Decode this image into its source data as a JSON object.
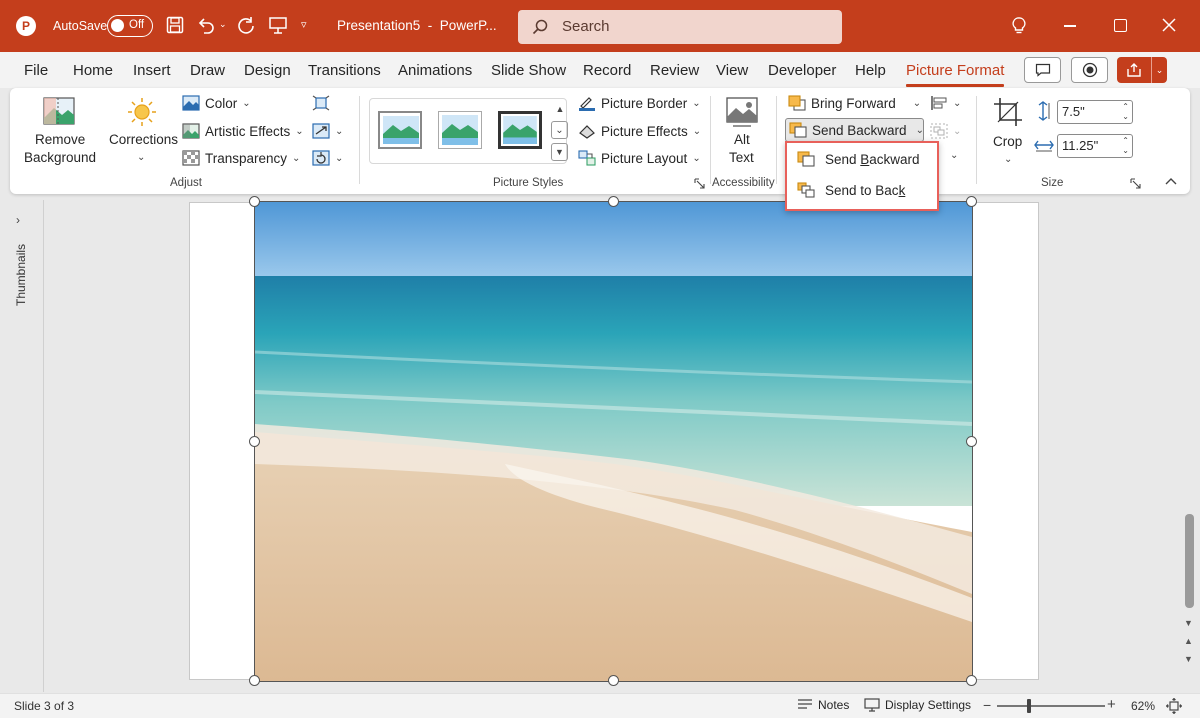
{
  "titlebar": {
    "autosave_label": "AutoSave",
    "autosave_state": "Off",
    "document_title": "Presentation5  -  PowerP...",
    "search_placeholder": "Search"
  },
  "menu_tabs": [
    "File",
    "Home",
    "Insert",
    "Draw",
    "Design",
    "Transitions",
    "Animations",
    "Slide Show",
    "Record",
    "Review",
    "View",
    "Developer",
    "Help",
    "Picture Format"
  ],
  "active_tab": "Picture Format",
  "ribbon": {
    "adjust": {
      "remove_background_line1": "Remove",
      "remove_background_line2": "Background",
      "corrections": "Corrections",
      "color": "Color",
      "artistic_effects": "Artistic Effects",
      "transparency": "Transparency",
      "group_label": "Adjust"
    },
    "picture_styles": {
      "picture_border": "Picture Border",
      "picture_effects": "Picture Effects",
      "picture_layout": "Picture Layout",
      "group_label": "Picture Styles"
    },
    "accessibility": {
      "alt_text_line1": "Alt",
      "alt_text_line2": "Text",
      "group_label": "Accessibility"
    },
    "arrange": {
      "bring_forward": "Bring Forward",
      "send_backward": "Send Backward"
    },
    "size": {
      "crop": "Crop",
      "height": "7.5\"",
      "width": "11.25\"",
      "group_label": "Size"
    }
  },
  "dropdown": {
    "items": [
      {
        "pre": "Send ",
        "key": "B",
        "post": "ackward"
      },
      {
        "pre": "Send to Bac",
        "key": "k",
        "post": ""
      }
    ]
  },
  "left_panel": {
    "label": "Thumbnails"
  },
  "statusbar": {
    "slide_info": "Slide 3 of 3",
    "notes": "Notes",
    "display_settings": "Display Settings",
    "zoom": "62%",
    "zoom_level": 0.6
  },
  "colors": {
    "accent": "#c43e1c",
    "highlight_border": "#e8605a"
  }
}
